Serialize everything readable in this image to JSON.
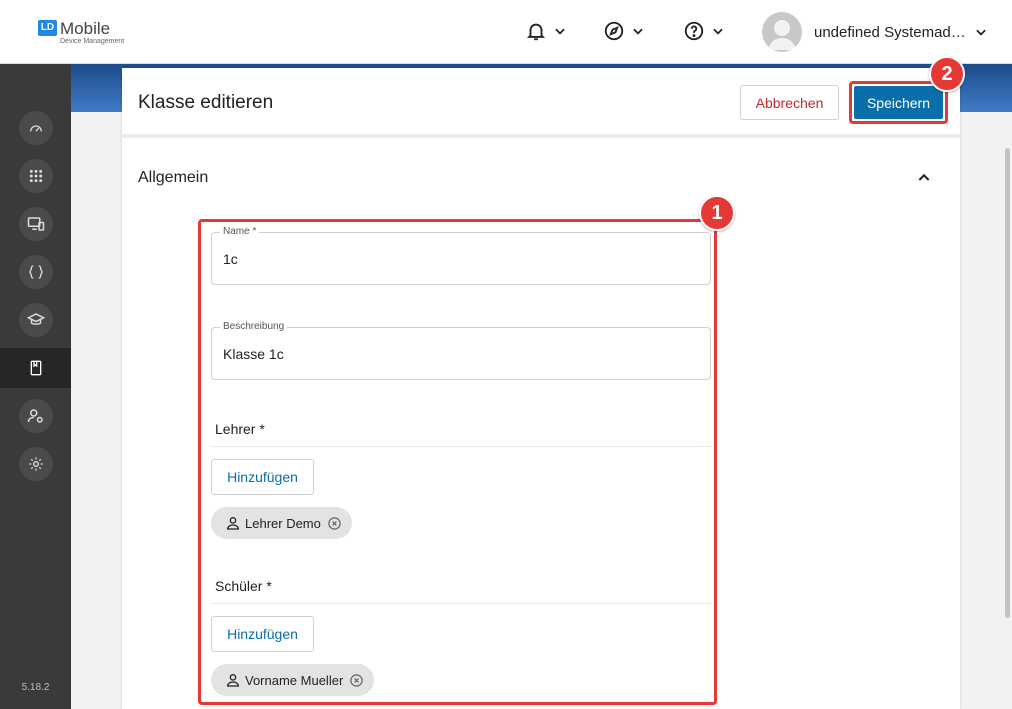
{
  "header": {
    "logo_title": "Mobile",
    "logo_subtitle": "Device Management",
    "logo_mark": "LD",
    "icons": [
      "bell-icon",
      "compass-icon",
      "help-icon"
    ],
    "user_name": "undefined Systemadmi..."
  },
  "sidebar": {
    "items": [
      {
        "icon": "dashboard-icon"
      },
      {
        "icon": "apps-grid-icon"
      },
      {
        "icon": "devices-icon"
      },
      {
        "icon": "code-braces-icon"
      },
      {
        "icon": "school-icon"
      },
      {
        "icon": "class-book-icon",
        "active": true
      },
      {
        "icon": "user-settings-icon"
      },
      {
        "icon": "settings-gear-icon"
      }
    ],
    "version": "5.18.2"
  },
  "card": {
    "title": "Klasse editieren",
    "cancel_label": "Abbrechen",
    "save_label": "Speichern",
    "section_title": "Allgemein"
  },
  "form": {
    "name_label": "Name *",
    "name_value": "1c",
    "description_label": "Beschreibung",
    "description_value": "Klasse 1c",
    "teachers_label": "Lehrer *",
    "teachers_add": "Hinzufügen",
    "teachers": [
      "Lehrer Demo"
    ],
    "students_label": "Schüler *",
    "students_add": "Hinzufügen",
    "students": [
      "Vorname Mueller"
    ]
  },
  "callouts": {
    "one": "1",
    "two": "2"
  },
  "colors": {
    "accent": "#0a6ea8",
    "danger": "#e53935",
    "sidebar": "#3a3a3a"
  }
}
